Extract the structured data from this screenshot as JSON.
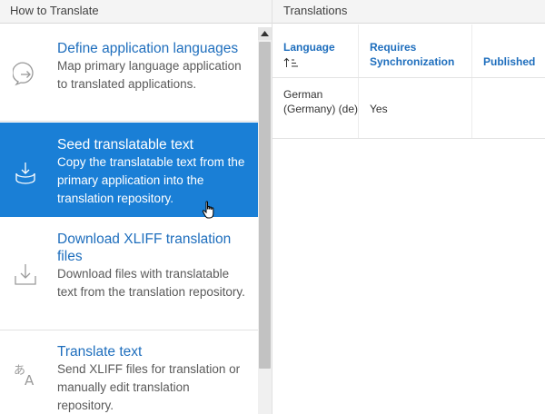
{
  "left_panel": {
    "header": "How to Translate",
    "tasks": [
      {
        "title": "Define application languages",
        "description": "Map primary language application to translated applications.",
        "icon": "arrow-circle-icon",
        "selected": false
      },
      {
        "title": "Seed translatable text",
        "description": "Copy the translatable text from the primary application into the translation repository.",
        "icon": "tray-download-icon",
        "selected": true
      },
      {
        "title": "Download XLIFF translation files",
        "description": "Download files with translatable text from the translation repository.",
        "icon": "download-icon",
        "selected": false
      },
      {
        "title": "Translate text",
        "description": "Send XLIFF files for translation or manually edit translation repository.",
        "icon": "translate-icon",
        "selected": false
      }
    ]
  },
  "right_panel": {
    "header": "Translations",
    "columns": [
      "Language",
      "Requires Synchronization",
      "Published"
    ],
    "rows": [
      {
        "language": "German (Germany) (de)",
        "requires_sync": "Yes",
        "published": ""
      }
    ]
  },
  "colors": {
    "accent": "#1a7fd6",
    "link": "#1e6ebd"
  }
}
